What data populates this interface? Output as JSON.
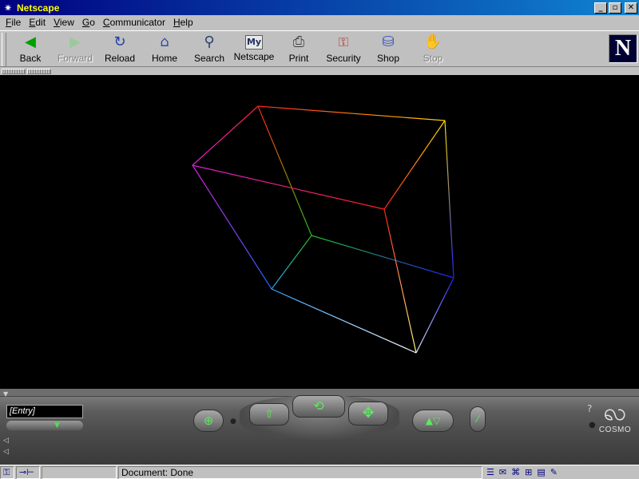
{
  "window": {
    "title": "Netscape",
    "min_label": "_",
    "max_label": "▫",
    "close_label": "✕"
  },
  "menu": {
    "items": [
      {
        "underline": "F",
        "rest": "ile"
      },
      {
        "underline": "E",
        "rest": "dit"
      },
      {
        "underline": "V",
        "rest": "iew"
      },
      {
        "underline": "G",
        "rest": "o"
      },
      {
        "underline": "C",
        "rest": "ommunicator"
      },
      {
        "underline": "H",
        "rest": "elp"
      }
    ]
  },
  "toolbar": {
    "buttons": [
      {
        "label": "Back",
        "icon": "back-arrow-icon",
        "glyph": "◀",
        "color": "#00a000",
        "enabled": true
      },
      {
        "label": "Forward",
        "icon": "forward-arrow-icon",
        "glyph": "▶",
        "color": "#9cc89c",
        "enabled": false
      },
      {
        "label": "Reload",
        "icon": "reload-icon",
        "glyph": "↻",
        "color": "#2040a0",
        "enabled": true
      },
      {
        "label": "Home",
        "icon": "home-icon",
        "glyph": "⌂",
        "color": "#3050a0",
        "enabled": true
      },
      {
        "label": "Search",
        "icon": "search-icon",
        "glyph": "⚲",
        "color": "#304070",
        "enabled": true
      },
      {
        "label": "Netscape",
        "icon": "my-netscape-icon",
        "glyph": "My",
        "color": "#203060",
        "enabled": true
      },
      {
        "label": "Print",
        "icon": "print-icon",
        "glyph": "⎙",
        "color": "#404040",
        "enabled": true
      },
      {
        "label": "Security",
        "icon": "security-lock-icon",
        "glyph": "🔒",
        "color": "#c03020",
        "enabled": true
      },
      {
        "label": "Shop",
        "icon": "shop-bag-icon",
        "glyph": "⛁",
        "color": "#3050c0",
        "enabled": true
      },
      {
        "label": "Stop",
        "icon": "stop-icon",
        "glyph": "✋",
        "color": "#9a9ab8",
        "enabled": false
      }
    ],
    "logo_letter": "N"
  },
  "scene": {
    "background": "#000000",
    "description_icon": "vrml-wireframe-cube"
  },
  "dashboard": {
    "entry_value": "[Entry]",
    "brand": "COSMO",
    "help_label": "?"
  },
  "status": {
    "text": "Document: Done"
  }
}
